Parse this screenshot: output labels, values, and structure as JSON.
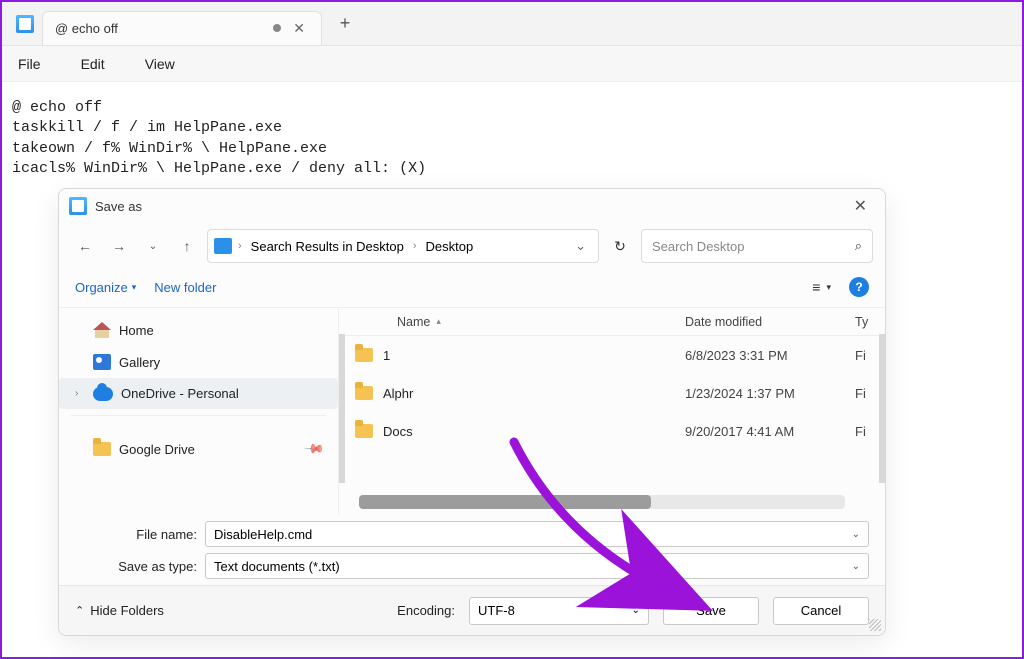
{
  "notepad": {
    "tab_title": "@ echo off",
    "menu": {
      "file": "File",
      "edit": "Edit",
      "view": "View"
    },
    "content": "@ echo off\ntaskkill / f / im HelpPane.exe\ntakeown / f% WinDir% \\ HelpPane.exe\nicacls% WinDir% \\ HelpPane.exe / deny all: (X)"
  },
  "dialog": {
    "title": "Save as",
    "breadcrumb": {
      "seg1": "Search Results in Desktop",
      "seg2": "Desktop"
    },
    "search_placeholder": "Search Desktop",
    "toolbar": {
      "organize": "Organize",
      "new_folder": "New folder"
    },
    "sidebar": {
      "home": "Home",
      "gallery": "Gallery",
      "onedrive": "OneDrive - Personal",
      "gdrive": "Google Drive"
    },
    "columns": {
      "name": "Name",
      "date": "Date modified",
      "type": "Ty"
    },
    "rows": [
      {
        "name": "1",
        "date": "6/8/2023 3:31 PM",
        "type": "Fi"
      },
      {
        "name": "Alphr",
        "date": "1/23/2024 1:37 PM",
        "type": "Fi"
      },
      {
        "name": "Docs",
        "date": "9/20/2017 4:41 AM",
        "type": "Fi"
      }
    ],
    "file_name_label": "File name:",
    "file_name_value": "DisableHelp.cmd",
    "save_type_label": "Save as type:",
    "save_type_value": "Text documents (*.txt)",
    "hide_folders": "Hide Folders",
    "encoding_label": "Encoding:",
    "encoding_value": "UTF-8",
    "save": "Save",
    "cancel": "Cancel"
  }
}
